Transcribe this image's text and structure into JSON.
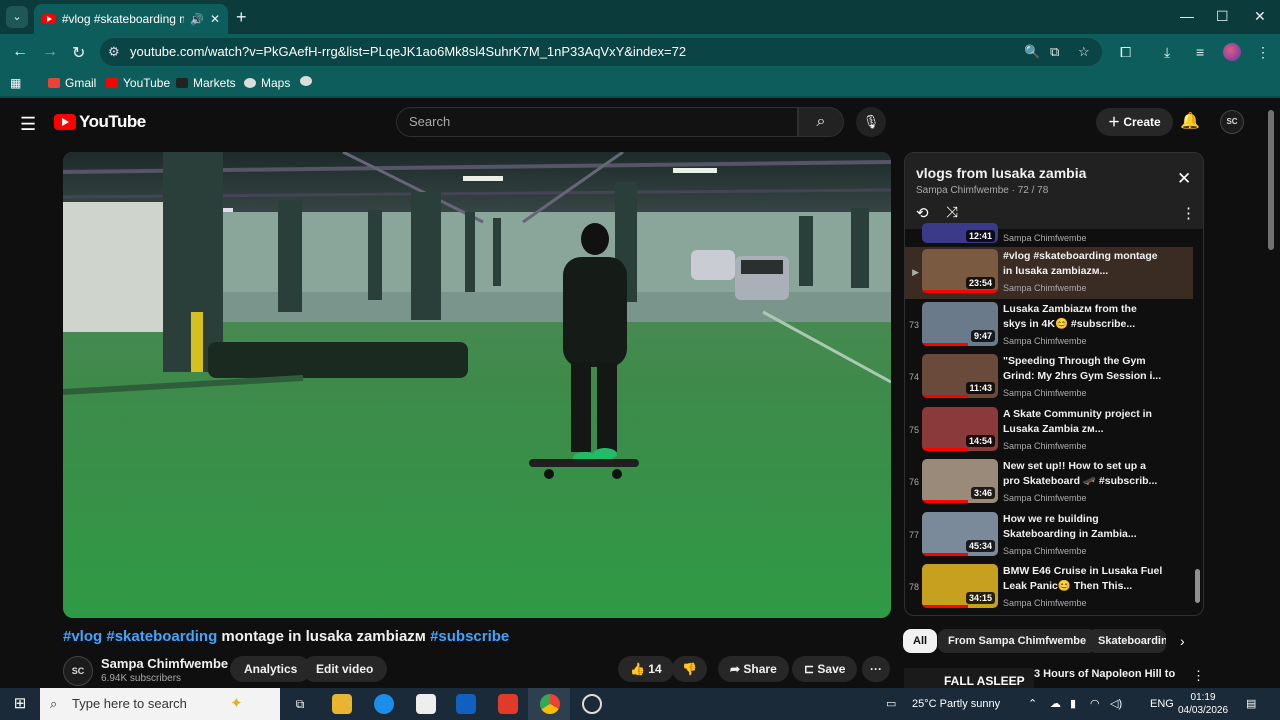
{
  "browser": {
    "tab_title": "#vlog #skateboarding mon",
    "url": "youtube.com/watch?v=PkGAefH-rrg&list=PLqeJK1ao6Mk8sl4SuhrK7M_1nP33AqVxY&index=72",
    "bookmarks": [
      "Gmail",
      "YouTube",
      "Markets",
      "Maps"
    ]
  },
  "youtube": {
    "logo_text": "YouTube",
    "search_placeholder": "Search",
    "create_label": "Create",
    "avatar_text": "SC"
  },
  "video": {
    "title_parts": [
      "#vlog",
      " ",
      "#skateboarding",
      " montage in lusaka zambiaᴢᴍ ",
      "#subscribe"
    ],
    "channel": "Sampa Chimfwembe",
    "subscribers": "6.94K subscribers",
    "analytics_label": "Analytics",
    "edit_label": "Edit video",
    "likes": "14",
    "share_label": "Share",
    "save_label": "Save"
  },
  "playlist": {
    "title": "vlogs from lusaka zambia",
    "meta": "Sampa Chimfwembe · 72 / 78",
    "partial_item": {
      "duration": "12:41",
      "channel": "Sampa Chimfwembe"
    },
    "items": [
      {
        "index": "▶",
        "title": "#vlog #skateboarding montage in lusaka zambiaᴢᴍ...",
        "duration": "23:54",
        "channel": "Sampa Chimfwembe",
        "active": true,
        "thumb": "#7a5a40"
      },
      {
        "index": "73",
        "title": "Lusaka Zambiaᴢᴍ from the skys in 4K😊 #subscribe...",
        "duration": "9:47",
        "channel": "Sampa Chimfwembe",
        "active": false,
        "thumb": "#6a7a8a"
      },
      {
        "index": "74",
        "title": "\"Speeding Through the Gym Grind: My 2hrs Gym Session i...",
        "duration": "11:43",
        "channel": "Sampa Chimfwembe",
        "active": false,
        "thumb": "#6a4a3a"
      },
      {
        "index": "75",
        "title": "A Skate Community project in Lusaka Zambia ᴢᴍ...",
        "duration": "14:54",
        "channel": "Sampa Chimfwembe",
        "active": false,
        "thumb": "#8a3a3a"
      },
      {
        "index": "76",
        "title": "New set up!! How to set up a pro Skateboard 🛹 #subscrib...",
        "duration": "3:46",
        "channel": "Sampa Chimfwembe",
        "active": false,
        "thumb": "#9a8a7a"
      },
      {
        "index": "77",
        "title": "How we re building Skateboarding in Zambia...",
        "duration": "45:34",
        "channel": "Sampa Chimfwembe",
        "active": false,
        "thumb": "#7a8a9a"
      },
      {
        "index": "78",
        "title": "BMW E46 Cruise in Lusaka Fuel Leak Panic😊 Then This...",
        "duration": "34:15",
        "channel": "Sampa Chimfwembe",
        "active": false,
        "thumb": "#c8a020"
      }
    ]
  },
  "chips": [
    "All",
    "From Sampa Chimfwembe",
    "Skateboarding"
  ],
  "recommendation_peek": {
    "thumb_text": "FALL ASLEEP",
    "title": "3 Hours of Napoleon Hill to"
  },
  "taskbar": {
    "search_placeholder": "Type here to search",
    "weather": "25°C  Partly sunny",
    "lang": "ENG",
    "time": "01:19",
    "date": "04/03/2026"
  }
}
